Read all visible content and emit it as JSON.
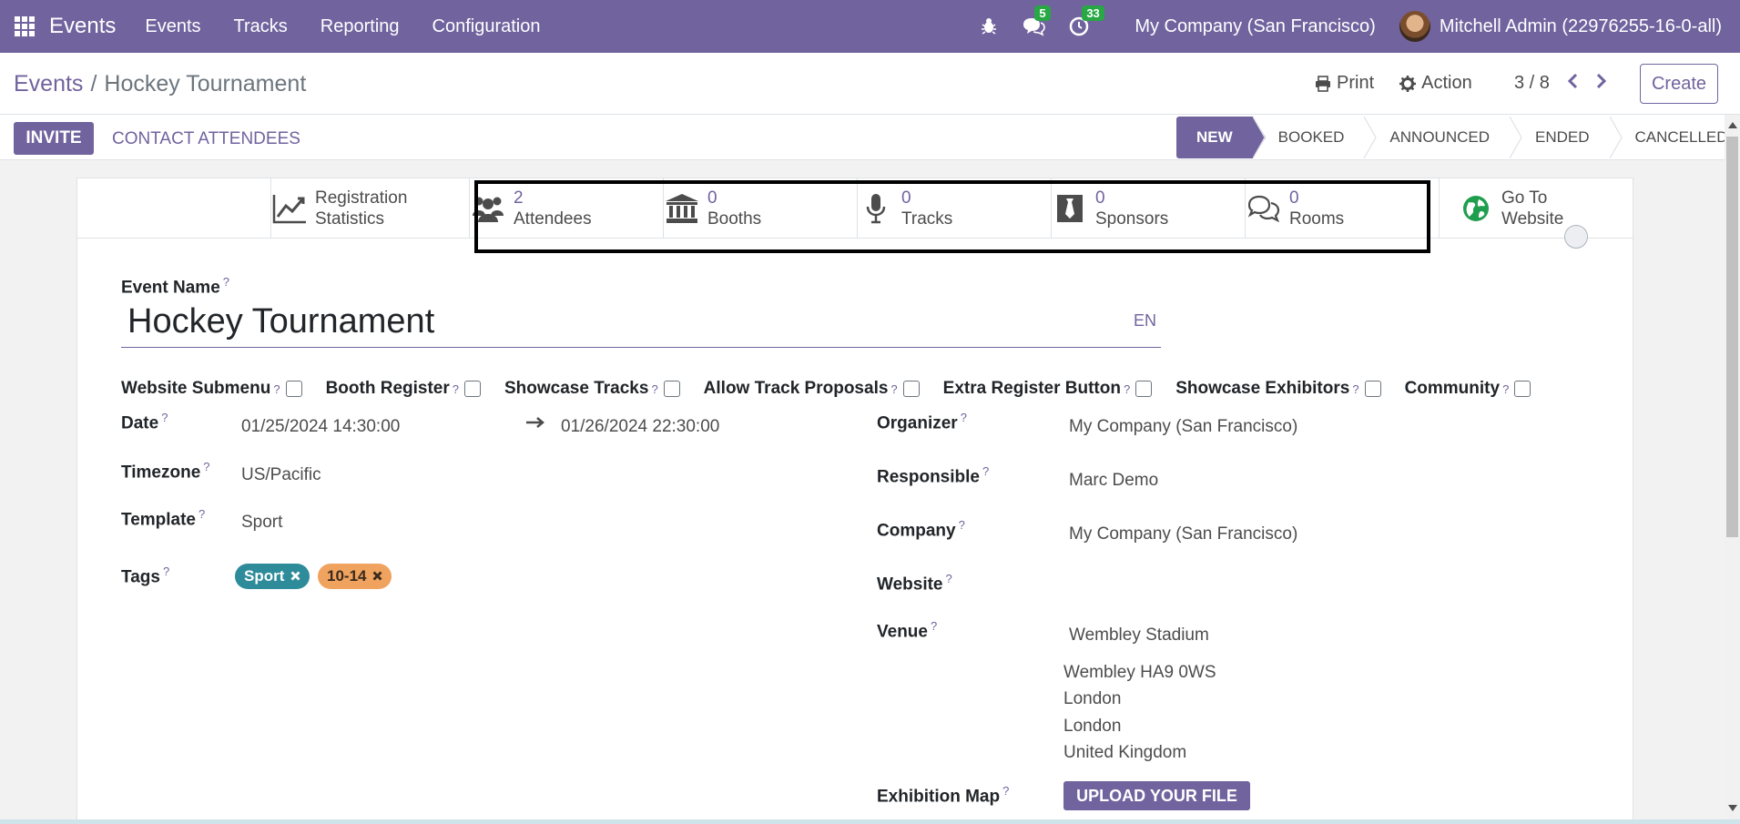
{
  "navbar": {
    "app_name": "Events",
    "menus": [
      "Events",
      "Tracks",
      "Reporting",
      "Configuration"
    ],
    "messages_count": "5",
    "activities_count": "33",
    "company": "My Company (San Francisco)",
    "user": "Mitchell Admin (22976255-16-0-all)",
    "accent_color": "#71639e"
  },
  "breadcrumb": {
    "parent": "Events",
    "separator": "/",
    "current": "Hockey Tournament"
  },
  "control": {
    "print_label": "Print",
    "action_label": "Action",
    "pager": "3 / 8",
    "create_label": "Create"
  },
  "statusbar": {
    "invite_label": "INVITE",
    "contact_label": "CONTACT ATTENDEES",
    "stages": [
      "NEW",
      "BOOKED",
      "ANNOUNCED",
      "ENDED",
      "CANCELLED"
    ],
    "active_stage": "NEW"
  },
  "smart_buttons": {
    "registration": {
      "line1": "Registration",
      "line2": "Statistics"
    },
    "attendees": {
      "value": "2",
      "label": "Attendees"
    },
    "booths": {
      "value": "0",
      "label": "Booths"
    },
    "tracks": {
      "value": "0",
      "label": "Tracks"
    },
    "sponsors": {
      "value": "0",
      "label": "Sponsors"
    },
    "rooms": {
      "value": "0",
      "label": "Rooms"
    },
    "website": {
      "line1": "Go To",
      "line2": "Website"
    }
  },
  "form": {
    "event_name_label": "Event Name",
    "event_name": "Hockey Tournament",
    "lang": "EN",
    "help": "?",
    "checkboxes": [
      "Website Submenu",
      "Booth Register",
      "Showcase Tracks",
      "Allow Track Proposals",
      "Extra Register Button",
      "Showcase Exhibitors",
      "Community"
    ],
    "date_label": "Date",
    "date_start": "01/25/2024 14:30:00",
    "date_end": "01/26/2024 22:30:00",
    "timezone_label": "Timezone",
    "timezone": "US/Pacific",
    "template_label": "Template",
    "template": "Sport",
    "tags_label": "Tags",
    "tags": [
      {
        "name": "Sport",
        "color": "#2e8b9a"
      },
      {
        "name": "10-14",
        "color": "#f0a35e"
      }
    ],
    "organizer_label": "Organizer",
    "organizer": "My Company (San Francisco)",
    "responsible_label": "Responsible",
    "responsible": "Marc Demo",
    "company_label": "Company",
    "company": "My Company (San Francisco)",
    "website_label": "Website",
    "venue_label": "Venue",
    "venue": "Wembley Stadium",
    "venue_address": [
      "Wembley HA9 0WS",
      "London",
      "London",
      "United Kingdom"
    ],
    "exhibition_map_label": "Exhibition Map",
    "upload_label": "UPLOAD YOUR FILE"
  }
}
